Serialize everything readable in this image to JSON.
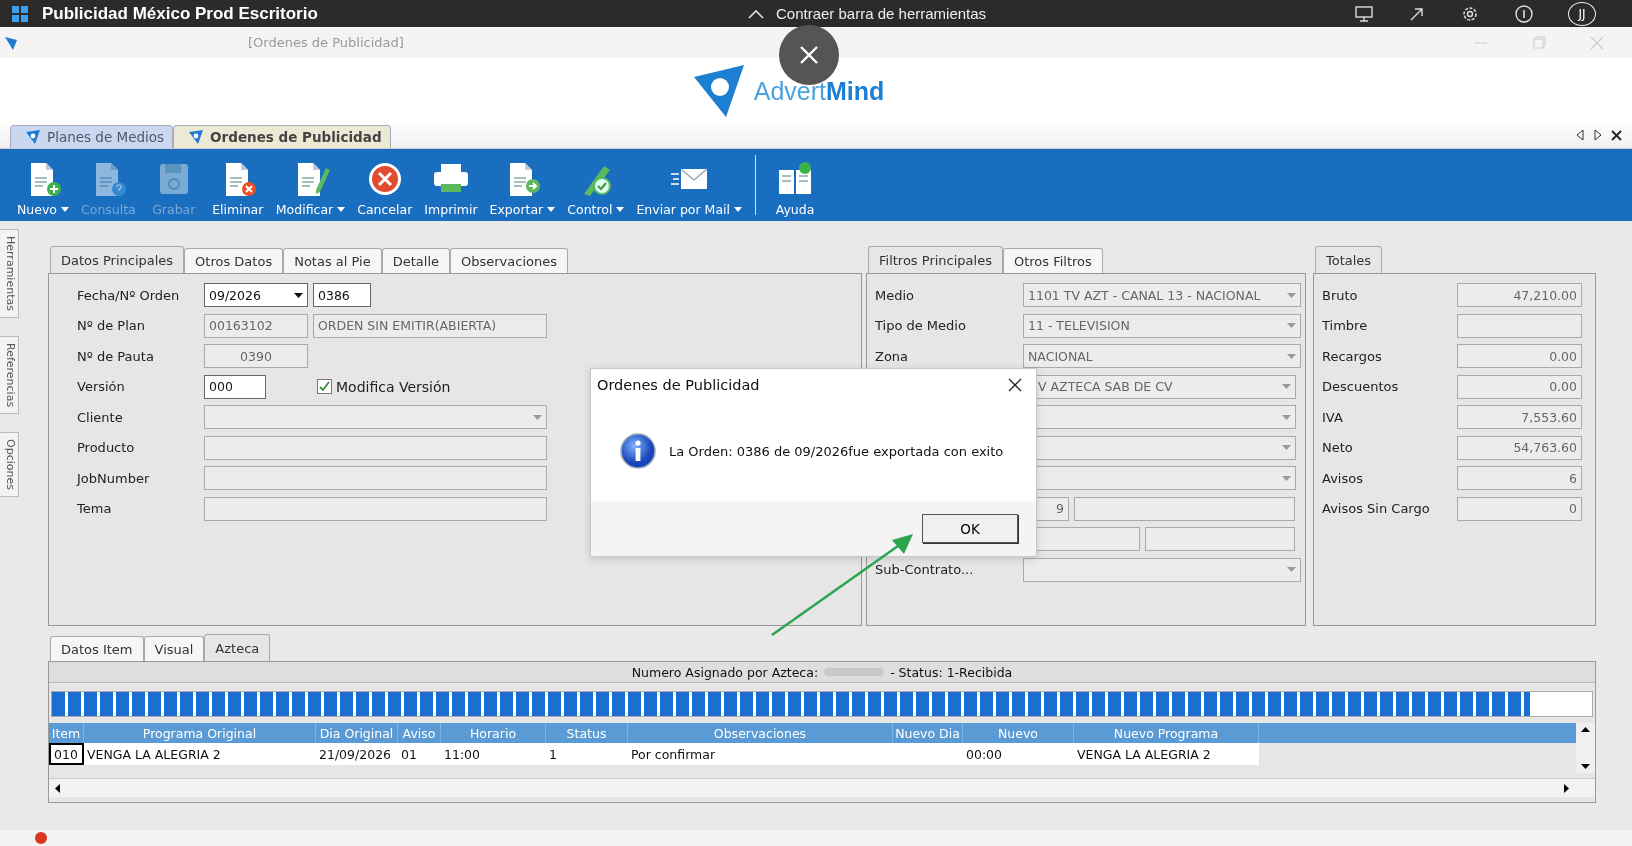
{
  "top_bar": {
    "title": "Publicidad México Prod Escritorio",
    "collapse_label": "Contraer barra de herramientas",
    "avatar": "JJ"
  },
  "window": {
    "title": "[Ordenes de Publicidad]"
  },
  "logo": {
    "part_a": "Advert",
    "part_b": "Mind"
  },
  "doc_tabs": [
    {
      "label": "Planes de Medios",
      "selected": false
    },
    {
      "label": "Ordenes de Publicidad",
      "selected": true
    }
  ],
  "toolbar": [
    {
      "label": "Nuevo",
      "kind": "new",
      "dropdown": true,
      "disabled": false
    },
    {
      "label": "Consulta",
      "kind": "query",
      "dropdown": false,
      "disabled": true
    },
    {
      "label": "Grabar",
      "kind": "save",
      "dropdown": false,
      "disabled": true
    },
    {
      "label": "Eliminar",
      "kind": "delete",
      "dropdown": false,
      "disabled": false
    },
    {
      "label": "Modificar",
      "kind": "edit",
      "dropdown": true,
      "disabled": false
    },
    {
      "label": "Cancelar",
      "kind": "cancel",
      "dropdown": false,
      "disabled": false
    },
    {
      "label": "Imprimir",
      "kind": "print",
      "dropdown": false,
      "disabled": false
    },
    {
      "label": "Exportar",
      "kind": "export",
      "dropdown": true,
      "disabled": false
    },
    {
      "label": "Control",
      "kind": "control",
      "dropdown": true,
      "disabled": false
    },
    {
      "label": "Enviar por Mail",
      "kind": "mail",
      "dropdown": true,
      "disabled": false
    },
    {
      "label": "Ayuda",
      "kind": "help",
      "dropdown": false,
      "disabled": false
    }
  ],
  "side_tabs": [
    "Herramientas",
    "Referencias",
    "Opciones"
  ],
  "main_panel": {
    "tabs": [
      {
        "label": "Datos Principales",
        "selected": true
      },
      {
        "label": "Otros Datos",
        "selected": false
      },
      {
        "label": "Notas al Pie",
        "selected": false
      },
      {
        "label": "Detalle",
        "selected": false
      },
      {
        "label": "Observaciones",
        "selected": false
      }
    ],
    "rows": [
      {
        "label": "Fecha/Nº Orden",
        "fields": [
          {
            "kind": "combo",
            "value": "09/2026",
            "disabled": false
          },
          {
            "kind": "text",
            "value": "0386",
            "disabled": false
          }
        ]
      },
      {
        "label": "Nº de Plan",
        "fields": [
          {
            "kind": "text",
            "value": "00163102",
            "disabled": true
          },
          {
            "kind": "text",
            "value": "ORDEN SIN EMITIR(ABIERTA)",
            "disabled": true
          }
        ]
      },
      {
        "label": "Nº de Pauta",
        "fields": [
          {
            "kind": "text",
            "value": "0390",
            "disabled": true
          }
        ]
      },
      {
        "label": "Versión",
        "fields": [
          {
            "kind": "text",
            "value": "000",
            "disabled": false
          },
          {
            "kind": "checkbox",
            "value": "Modifica Versión",
            "checked": true
          }
        ]
      },
      {
        "label": "Cliente",
        "fields": [
          {
            "kind": "combo",
            "disabled": true
          }
        ]
      },
      {
        "label": "Producto",
        "fields": [
          {
            "kind": "text",
            "disabled": true
          }
        ]
      },
      {
        "label": "JobNumber",
        "fields": [
          {
            "kind": "text",
            "disabled": true
          }
        ]
      },
      {
        "label": "Tema",
        "fields": [
          {
            "kind": "text",
            "disabled": true
          }
        ]
      }
    ]
  },
  "filter_panel": {
    "tabs": [
      {
        "label": "Filtros Principales",
        "selected": true
      },
      {
        "label": "Otros Filtros",
        "selected": false
      }
    ],
    "rows": [
      {
        "label": "Medio",
        "fields": [
          {
            "kind": "combo",
            "value": "1101 TV AZT - CANAL 13 - NACIONAL",
            "disabled": true
          }
        ]
      },
      {
        "label": "Tipo de Medio",
        "fields": [
          {
            "kind": "combo",
            "value": "11 - TELEVISION",
            "disabled": true
          }
        ]
      },
      {
        "label": "Zona",
        "fields": [
          {
            "kind": "combo",
            "value": "NACIONAL",
            "disabled": true
          }
        ]
      },
      {
        "fields": [
          {
            "kind": "combo",
            "value": "V AZTECA SAB DE CV",
            "disabled": true
          }
        ]
      },
      {
        "fields": [
          {
            "kind": "combo",
            "disabled": true
          }
        ]
      },
      {
        "fields": [
          {
            "kind": "combo",
            "disabled": true
          }
        ]
      },
      {
        "fields": [
          {
            "kind": "combo",
            "disabled": true
          }
        ]
      },
      {
        "fields": [
          {
            "kind": "text",
            "value": "9",
            "disabled": true
          },
          {
            "kind": "text",
            "disabled": true
          }
        ]
      },
      {
        "fields": [
          {
            "kind": "text",
            "disabled": true
          },
          {
            "kind": "text",
            "disabled": true
          }
        ]
      },
      {
        "label": "Sub-Contrato...",
        "fields": [
          {
            "kind": "combo",
            "disabled": true
          }
        ]
      }
    ]
  },
  "totals_panel": {
    "tabs": [
      {
        "label": "Totales",
        "selected": true
      }
    ],
    "rows": [
      {
        "label": "Bruto",
        "value": "47,210.00"
      },
      {
        "label": "Timbre"
      },
      {
        "label": "Recargos",
        "value": "0.00"
      },
      {
        "label": "Descuentos",
        "value": "0.00"
      },
      {
        "label": "IVA",
        "value": "7,553.60"
      },
      {
        "label": "Neto",
        "value": "54,763.60"
      },
      {
        "label": "Avisos",
        "value": "6"
      },
      {
        "label": "Avisos Sin Cargo",
        "value": "0"
      }
    ]
  },
  "bottom_panel": {
    "tabs": [
      {
        "label": "Datos Item",
        "selected": false
      },
      {
        "label": "Visual",
        "selected": false
      },
      {
        "label": "Azteca",
        "selected": true
      }
    ],
    "status_prefix": "Numero Asignado por Azteca:",
    "status_suffix": "- Status: 1-Recibida",
    "progress": {
      "level": 0.96
    },
    "table": {
      "columns": [
        "Item",
        "Programa Original",
        "Dia Original",
        "Aviso",
        "Horario",
        "Status",
        "Observaciones",
        "Nuevo Dia",
        "Nuevo",
        "Nuevo Programa"
      ],
      "rows": [
        {
          "cells": [
            {
              "text": "010",
              "selected": true
            },
            {
              "text": "VENGA LA ALEGRIA 2",
              "selected": false
            },
            {
              "text": "21/09/2026",
              "selected": false
            },
            {
              "text": "01",
              "selected": false
            },
            {
              "text": "11:00",
              "selected": false
            },
            {
              "text": "1",
              "selected": false
            },
            {
              "text": "Por confirmar",
              "selected": false
            },
            {
              "text": "",
              "selected": false
            },
            {
              "text": "00:00",
              "selected": false
            },
            {
              "text": "VENGA LA ALEGRIA 2",
              "selected": false
            }
          ]
        }
      ]
    }
  },
  "dialog": {
    "title": "Ordenes de Publicidad",
    "kind": "info",
    "message": "La Orden: 0386 de 09/2026fue exportada con exito",
    "button": "OK"
  }
}
